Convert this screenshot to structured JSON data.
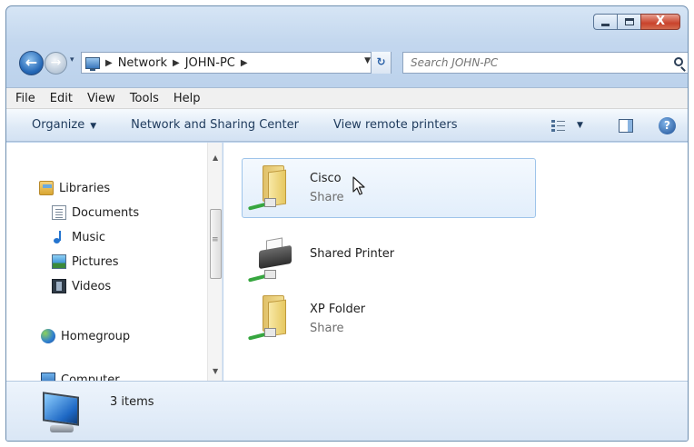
{
  "window": {
    "caption": {
      "minimize_label": "",
      "maximize_label": "",
      "close_label": "X"
    }
  },
  "navigation": {
    "back_glyph": "←",
    "forward_glyph": "→",
    "recent_glyph": "▾"
  },
  "address": {
    "breadcrumbs": [
      "Network",
      "JOHN-PC"
    ],
    "separator": "▶",
    "dropdown_glyph": "▼",
    "refresh_glyph": "↻"
  },
  "search": {
    "placeholder": "Search JOHN-PC"
  },
  "menu": [
    "File",
    "Edit",
    "View",
    "Tools",
    "Help"
  ],
  "commands": {
    "organize": "Organize",
    "organize_caret": "▼",
    "network_center": "Network and Sharing Center",
    "remote_printers": "View remote printers",
    "views_caret": "▼",
    "help_glyph": "?"
  },
  "nav_pane": {
    "libraries": "Libraries",
    "library_items": [
      "Documents",
      "Music",
      "Pictures",
      "Videos"
    ],
    "homegroup": "Homegroup",
    "computer": "Computer",
    "scroll_up_glyph": "▲",
    "scroll_down_glyph": "▼"
  },
  "items": [
    {
      "name": "Cisco",
      "type": "Share",
      "icon": "shared-folder-icon",
      "selected": true
    },
    {
      "name": "Shared Printer",
      "type": "",
      "icon": "shared-printer-icon",
      "selected": false
    },
    {
      "name": "XP Folder",
      "type": "Share",
      "icon": "shared-folder-icon",
      "selected": false
    }
  ],
  "status": {
    "count": "3 items"
  },
  "colors": {
    "accent": "#2467b6",
    "selection_border": "#9ec4ea",
    "close_button": "#c9432c"
  }
}
